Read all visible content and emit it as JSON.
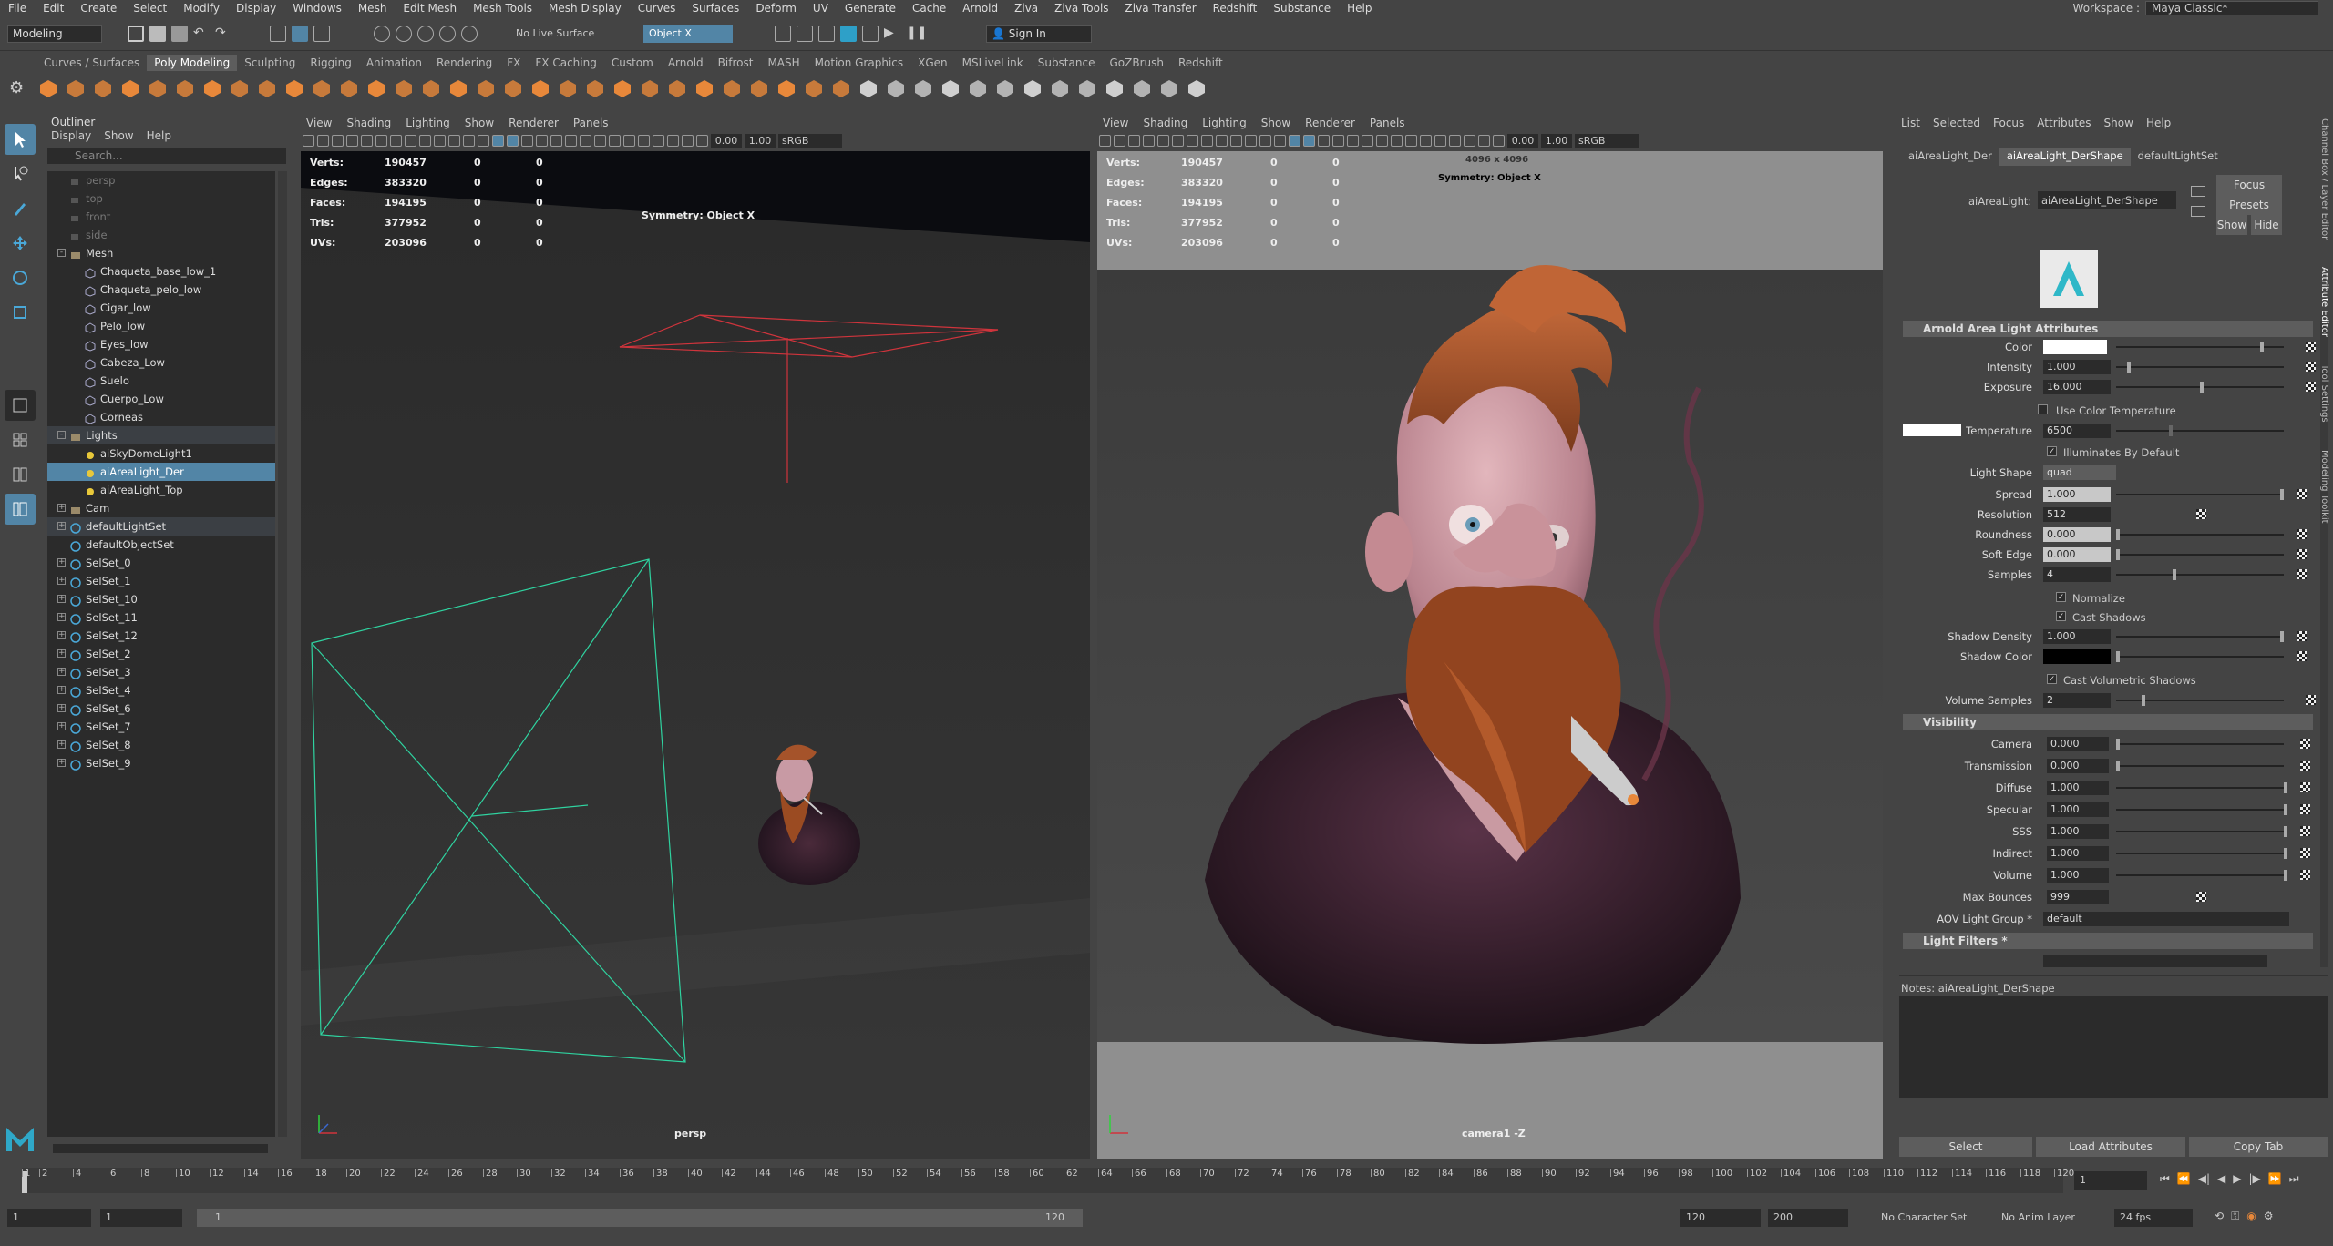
{
  "menubar": {
    "items": [
      "File",
      "Edit",
      "Create",
      "Select",
      "Modify",
      "Display",
      "Windows",
      "Mesh",
      "Edit Mesh",
      "Mesh Tools",
      "Mesh Display",
      "Curves",
      "Surfaces",
      "Deform",
      "UV",
      "Generate",
      "Cache",
      "Arnold",
      "Ziva",
      "Ziva Tools",
      "Ziva Transfer",
      "Redshift",
      "Substance",
      "Help"
    ],
    "workspace_label": "Workspace :",
    "workspace_value": "Maya Classic*"
  },
  "statusline": {
    "mode": "Modeling",
    "live_surface": "No Live Surface",
    "symmetry": "Object X",
    "sign_in": "Sign In"
  },
  "shelf": {
    "tabs": [
      "Curves / Surfaces",
      "Poly Modeling",
      "Sculpting",
      "Rigging",
      "Animation",
      "Rendering",
      "FX",
      "FX Caching",
      "Custom",
      "Arnold",
      "Bifrost",
      "MASH",
      "Motion Graphics",
      "XGen",
      "MSLiveLink",
      "Substance",
      "GoZBrush",
      "Redshift"
    ],
    "active": "Poly Modeling"
  },
  "outliner": {
    "title": "Outliner",
    "menu": [
      "Display",
      "Show",
      "Help"
    ],
    "search_placeholder": "Search...",
    "rows": [
      {
        "label": "persp",
        "indent": 1,
        "kind": "cam",
        "dim": true
      },
      {
        "label": "top",
        "indent": 1,
        "kind": "cam",
        "dim": true
      },
      {
        "label": "front",
        "indent": 1,
        "kind": "cam",
        "dim": true
      },
      {
        "label": "side",
        "indent": 1,
        "kind": "cam",
        "dim": true
      },
      {
        "label": "Mesh",
        "indent": 1,
        "kind": "group",
        "expander": "-"
      },
      {
        "label": "Chaqueta_base_low_1",
        "indent": 2,
        "kind": "mesh"
      },
      {
        "label": "Chaqueta_pelo_low",
        "indent": 2,
        "kind": "mesh"
      },
      {
        "label": "Cigar_low",
        "indent": 2,
        "kind": "mesh"
      },
      {
        "label": "Pelo_low",
        "indent": 2,
        "kind": "mesh"
      },
      {
        "label": "Eyes_low",
        "indent": 2,
        "kind": "mesh"
      },
      {
        "label": "Cabeza_Low",
        "indent": 2,
        "kind": "mesh"
      },
      {
        "label": "Suelo",
        "indent": 2,
        "kind": "mesh"
      },
      {
        "label": "Cuerpo_Low",
        "indent": 2,
        "kind": "mesh"
      },
      {
        "label": "Corneas",
        "indent": 2,
        "kind": "mesh"
      },
      {
        "label": "Lights",
        "indent": 1,
        "kind": "group",
        "expander": "-",
        "hl": true
      },
      {
        "label": "aiSkyDomeLight1",
        "indent": 2,
        "kind": "light"
      },
      {
        "label": "aiAreaLight_Der",
        "indent": 2,
        "kind": "light",
        "selected": true
      },
      {
        "label": "aiAreaLight_Top",
        "indent": 2,
        "kind": "light"
      },
      {
        "label": "Cam",
        "indent": 1,
        "kind": "group",
        "expander": "+"
      },
      {
        "label": "defaultLightSet",
        "indent": 1,
        "kind": "set",
        "expander": "+",
        "hl": true
      },
      {
        "label": "defaultObjectSet",
        "indent": 1,
        "kind": "set"
      },
      {
        "label": "SelSet_0",
        "indent": 1,
        "kind": "set",
        "expander": "+"
      },
      {
        "label": "SelSet_1",
        "indent": 1,
        "kind": "set",
        "expander": "+"
      },
      {
        "label": "SelSet_10",
        "indent": 1,
        "kind": "set",
        "expander": "+"
      },
      {
        "label": "SelSet_11",
        "indent": 1,
        "kind": "set",
        "expander": "+"
      },
      {
        "label": "SelSet_12",
        "indent": 1,
        "kind": "set",
        "expander": "+"
      },
      {
        "label": "SelSet_2",
        "indent": 1,
        "kind": "set",
        "expander": "+"
      },
      {
        "label": "SelSet_3",
        "indent": 1,
        "kind": "set",
        "expander": "+"
      },
      {
        "label": "SelSet_4",
        "indent": 1,
        "kind": "set",
        "expander": "+"
      },
      {
        "label": "SelSet_6",
        "indent": 1,
        "kind": "set",
        "expander": "+"
      },
      {
        "label": "SelSet_7",
        "indent": 1,
        "kind": "set",
        "expander": "+"
      },
      {
        "label": "SelSet_8",
        "indent": 1,
        "kind": "set",
        "expander": "+"
      },
      {
        "label": "SelSet_9",
        "indent": 1,
        "kind": "set",
        "expander": "+"
      }
    ]
  },
  "viewport_common": {
    "menu": [
      "View",
      "Shading",
      "Lighting",
      "Show",
      "Renderer",
      "Panels"
    ],
    "exposure": "0.00",
    "gamma": "1.00",
    "colorspace": "sRGB gamma",
    "hud_labels": [
      "Verts:",
      "Edges:",
      "Faces:",
      "Tris:",
      "UVs:"
    ],
    "hud_values": [
      "190457",
      "383320",
      "194195",
      "377952",
      "203096"
    ],
    "hud_zero": "0",
    "symmetry": "Symmetry: Object X"
  },
  "viewport_left": {
    "camera": "persp"
  },
  "viewport_right": {
    "camera": "camera1 -Z",
    "resolution": "4096 x 4096"
  },
  "attr_editor": {
    "menu": [
      "List",
      "Selected",
      "Focus",
      "Attributes",
      "Show",
      "Help"
    ],
    "tabs": [
      "aiAreaLight_Der",
      "aiAreaLight_DerShape",
      "defaultLightSet"
    ],
    "active_tab": "aiAreaLight_DerShape",
    "node_label": "aiAreaLight:",
    "node_value": "aiAreaLight_DerShape",
    "focus": "Focus",
    "presets": "Presets",
    "show": "Show",
    "hide": "Hide",
    "section_main": "Arnold Area Light Attributes",
    "color_label": "Color",
    "intensity_label": "Intensity",
    "intensity": "1.000",
    "exposure_label": "Exposure",
    "exposure": "16.000",
    "use_color_temp": "Use Color Temperature",
    "temperature_label": "Temperature",
    "temperature": "6500",
    "illuminates": "Illuminates By Default",
    "light_shape_label": "Light Shape",
    "light_shape": "quad",
    "spread_label": "Spread",
    "spread": "1.000",
    "resolution_label": "Resolution",
    "resolution": "512",
    "roundness_label": "Roundness",
    "roundness": "0.000",
    "soft_edge_label": "Soft Edge",
    "soft_edge": "0.000",
    "samples_label": "Samples",
    "samples": "4",
    "normalize": "Normalize",
    "cast_shadows": "Cast Shadows",
    "shadow_density_label": "Shadow Density",
    "shadow_density": "1.000",
    "shadow_color_label": "Shadow Color",
    "cast_volumetric": "Cast Volumetric Shadows",
    "volume_samples_label": "Volume Samples",
    "volume_samples": "2",
    "section_visibility": "Visibility",
    "camera_label": "Camera",
    "camera": "0.000",
    "transmission_label": "Transmission",
    "transmission": "0.000",
    "diffuse_label": "Diffuse",
    "diffuse": "1.000",
    "specular_label": "Specular",
    "specular": "1.000",
    "sss_label": "SSS",
    "sss": "1.000",
    "indirect_label": "Indirect",
    "indirect": "1.000",
    "volume_label": "Volume",
    "volume": "1.000",
    "max_bounces_label": "Max Bounces",
    "max_bounces": "999",
    "aov_label": "AOV Light Group *",
    "aov": "default",
    "section_filters": "Light Filters *",
    "notes_label": "Notes:",
    "notes_value": "aiAreaLight_DerShape",
    "btn_select": "Select",
    "btn_load": "Load Attributes",
    "btn_copy": "Copy Tab"
  },
  "side_tabs": [
    "Channel Box / Layer Editor",
    "Attribute Editor",
    "Tool Settings",
    "Modeling Toolkit"
  ],
  "timeline": {
    "ticks": [
      "1",
      "2",
      "4",
      "6",
      "8",
      "10",
      "12",
      "14",
      "16",
      "18",
      "20",
      "22",
      "24",
      "26",
      "28",
      "30",
      "32",
      "34",
      "36",
      "38",
      "40",
      "42",
      "44",
      "46",
      "48",
      "50",
      "52",
      "54",
      "56",
      "58",
      "60",
      "62",
      "64",
      "66",
      "68",
      "70",
      "72",
      "74",
      "76",
      "78",
      "80",
      "82",
      "84",
      "86",
      "88",
      "90",
      "92",
      "94",
      "96",
      "98",
      "100",
      "102",
      "104",
      "106",
      "108",
      "110",
      "112",
      "114",
      "116",
      "118",
      "120"
    ],
    "current_frame": "1"
  },
  "range": {
    "start": "1",
    "playback_start": "1",
    "range_start": "1",
    "range_end": "120",
    "playback_end": "120",
    "end": "200",
    "char_set": "No Character Set",
    "anim_layer": "No Anim Layer",
    "fps": "24 fps"
  },
  "colors": {
    "accent": "#5285a6",
    "light_green": "#2fd3a0",
    "light_red": "#d0343c",
    "icon_orange": "#e8883a"
  }
}
